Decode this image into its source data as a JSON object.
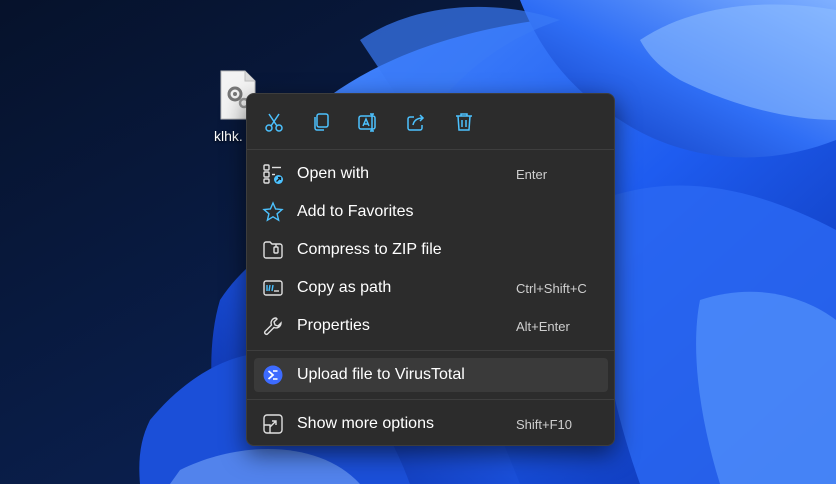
{
  "desktop": {
    "file_label": "klhk.",
    "file_icon": "settings-file-icon"
  },
  "toolbar": [
    {
      "name": "cut",
      "icon": "scissors-icon"
    },
    {
      "name": "copy",
      "icon": "copy-icon"
    },
    {
      "name": "rename",
      "icon": "rename-icon"
    },
    {
      "name": "share",
      "icon": "share-icon"
    },
    {
      "name": "delete",
      "icon": "trash-icon"
    }
  ],
  "menu": {
    "items": [
      {
        "label": "Open with",
        "shortcut": "Enter",
        "icon": "open-with-icon"
      },
      {
        "label": "Add to Favorites",
        "shortcut": "",
        "icon": "star-icon"
      },
      {
        "label": "Compress to ZIP file",
        "shortcut": "",
        "icon": "zip-folder-icon"
      },
      {
        "label": "Copy as path",
        "shortcut": "Ctrl+Shift+C",
        "icon": "copy-path-icon"
      },
      {
        "label": "Properties",
        "shortcut": "Alt+Enter",
        "icon": "wrench-icon"
      },
      {
        "label": "Upload file to VirusTotal",
        "shortcut": "",
        "icon": "virustotal-icon"
      },
      {
        "label": "Show more options",
        "shortcut": "Shift+F10",
        "icon": "more-options-icon"
      }
    ]
  },
  "colors": {
    "menu_bg": "#2c2c2c",
    "accent": "#4cc2ff",
    "hover": "#3a3a3a"
  }
}
